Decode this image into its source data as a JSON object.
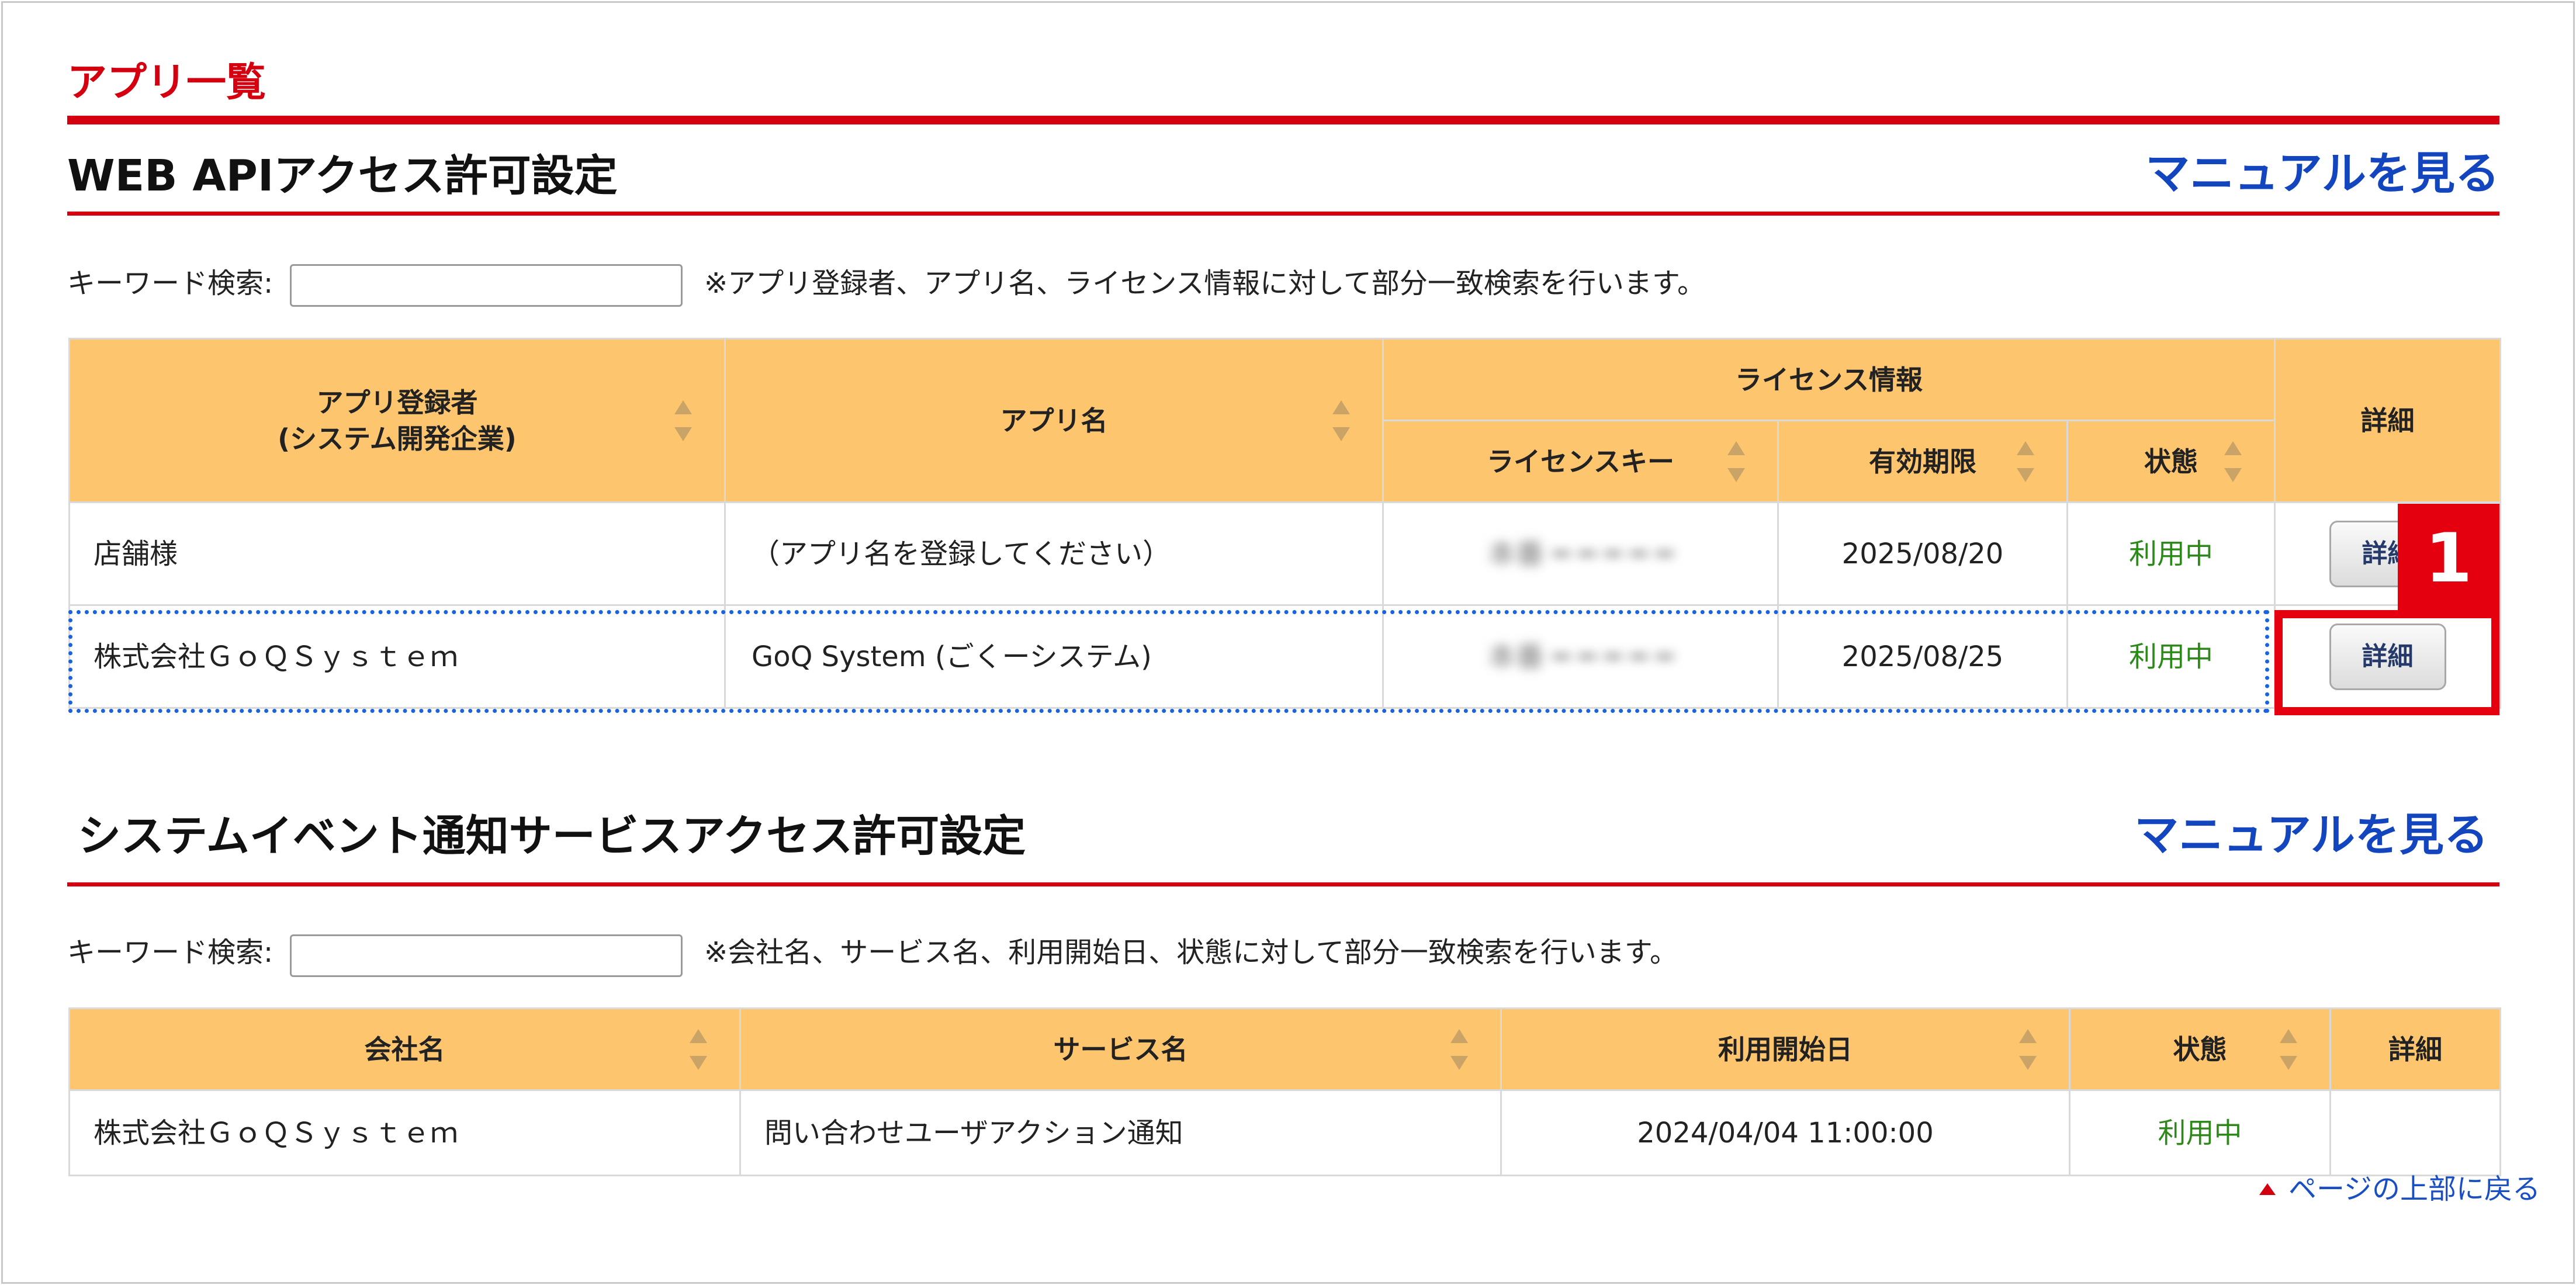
{
  "page_title": "アプリ一覧",
  "web_api": {
    "title": "WEB APIアクセス許可設定",
    "manual_link": "マニュアルを見る",
    "keyword_label": "キーワード検索:",
    "keyword_value": "",
    "keyword_note": "※アプリ登録者、アプリ名、ライセンス情報に対して部分一致検索を行います。",
    "headers": {
      "registrant_line1": "アプリ登録者",
      "registrant_line2": "(システム開発企業)",
      "app_name": "アプリ名",
      "license_info": "ライセンス情報",
      "license_key": "ライセンスキー",
      "expiry": "有効期限",
      "status": "状態",
      "detail": "詳細"
    },
    "rows": [
      {
        "registrant": "店舗様",
        "app_name": "（アプリ名を登録してください）",
        "license_key": "本番 ━ ━ ━ ━ ━",
        "expiry": "2025/08/20",
        "status": "利用中",
        "detail_button": "詳細"
      },
      {
        "registrant": "株式会社ＧｏＱＳｙｓｔｅｍ",
        "app_name": "GoQ System (ごくーシステム)",
        "license_key": "本番 ━ ━ ━ ━ ━",
        "expiry": "2025/08/25",
        "status": "利用中",
        "detail_button": "詳細"
      }
    ],
    "callout_badge": "1"
  },
  "event_notify": {
    "title": "システムイベント通知サービスアクセス許可設定",
    "manual_link": "マニュアルを見る",
    "keyword_label": "キーワード検索:",
    "keyword_value": "",
    "keyword_note": "※会社名、サービス名、利用開始日、状態に対して部分一致検索を行います。",
    "headers": {
      "company": "会社名",
      "service": "サービス名",
      "start_date": "利用開始日",
      "status": "状態",
      "detail": "詳細"
    },
    "rows": [
      {
        "company": "株式会社ＧｏＱＳｙｓｔｅｍ",
        "service": "問い合わせユーザアクション通知",
        "start_date": "2024/04/04 11:00:00",
        "status": "利用中"
      }
    ]
  },
  "back_to_top": "ページの上部に戻る",
  "colors": {
    "accent_red": "#d4000f",
    "link_blue": "#1345bf",
    "header_orange": "#fec56f",
    "status_green": "#2d8a1a",
    "focus_blue": "#1a63e0"
  }
}
